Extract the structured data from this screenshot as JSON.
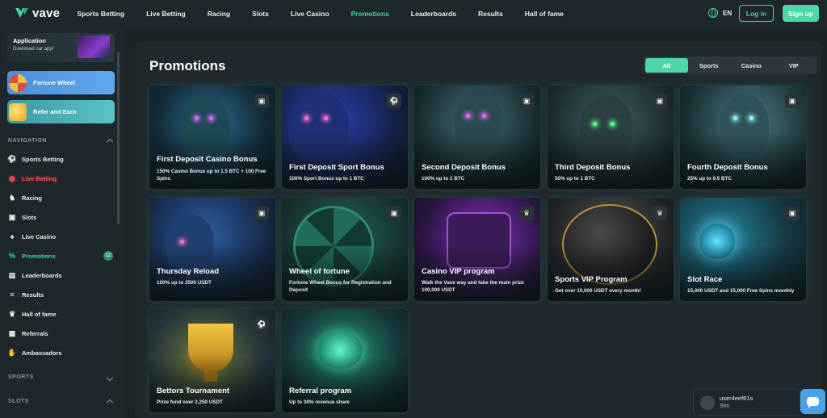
{
  "brand": {
    "name": "vave",
    "accent": "#3fd5a6"
  },
  "nav": {
    "items": [
      "Sports Betting",
      "Live Betting",
      "Racing",
      "Slots",
      "Live Casino",
      "Promotions",
      "Leaderboards",
      "Results",
      "Hall of fame"
    ],
    "active": "Promotions"
  },
  "header": {
    "language": "EN",
    "login_label": "Log in",
    "signup_label": "Sign up"
  },
  "sidebar": {
    "app_card": {
      "title": "Application",
      "subtitle": "Download our app!"
    },
    "promos": [
      {
        "label": "Fortune Wheel",
        "icon": "fortune-wheel-icon"
      },
      {
        "label": "Refer and Earn",
        "icon": "coin-icon"
      }
    ],
    "navigation_heading": "NAVIGATION",
    "items": [
      {
        "label": "Sports Betting",
        "icon": "soccer-ball-icon"
      },
      {
        "label": "Live Betting",
        "icon": "live-signal-icon"
      },
      {
        "label": "Racing",
        "icon": "horse-icon"
      },
      {
        "label": "Slots",
        "icon": "slot-machine-icon"
      },
      {
        "label": "Live Casino",
        "icon": "cards-icon"
      },
      {
        "label": "Promotions",
        "icon": "percent-icon",
        "badge": "12"
      },
      {
        "label": "Leaderboards",
        "icon": "leaderboard-icon"
      },
      {
        "label": "Results",
        "icon": "results-icon"
      },
      {
        "label": "Hall of fame",
        "icon": "trophy-icon"
      },
      {
        "label": "Referrals",
        "icon": "referrals-icon"
      },
      {
        "label": "Ambassadors",
        "icon": "handshake-icon"
      }
    ],
    "sports_heading": "SPORTS",
    "slots_heading": "SLOTS"
  },
  "main": {
    "title": "Promotions",
    "filters": [
      "All",
      "Sports",
      "Casino",
      "VIP"
    ],
    "active_filter": "All",
    "cards": [
      {
        "title": "First Deposit Casino Bonus",
        "desc": "150% Casino Bonus up to 1.5 BTC + 100 Free Spins",
        "tag_icon": "casino-chip-icon"
      },
      {
        "title": "First Deposit Sport Bonus",
        "desc": "100% Sport Bonus up to 1 BTC",
        "tag_icon": "soccer-ball-icon"
      },
      {
        "title": "Second Deposit Bonus",
        "desc": "100% up to 1 BTC",
        "tag_icon": "casino-chip-icon"
      },
      {
        "title": "Third Deposit Bonus",
        "desc": "50% up to 1 BTC",
        "tag_icon": "casino-chip-icon"
      },
      {
        "title": "Fourth Deposit Bonus",
        "desc": "25% up to 0.5 BTC",
        "tag_icon": "casino-chip-icon"
      },
      {
        "title": "Thursday Reload",
        "desc": "100% up to 2500 USDT",
        "tag_icon": "casino-chip-icon"
      },
      {
        "title": "Wheel of fortune",
        "desc": "Fortune Wheel Bonus for Registration and Deposit",
        "tag_icon": "casino-chip-icon"
      },
      {
        "title": "Casino VIP program",
        "desc": "Walk the Vave way and take the main prize 100,000 USDT",
        "tag_icon": "crown-icon"
      },
      {
        "title": "Sports VIP Program",
        "desc": "Get over 10,000 USDT every month!",
        "tag_icon": "crown-icon"
      },
      {
        "title": "Slot Race",
        "desc": "15,000 USDT and 15,000 Free Spins monthly",
        "tag_icon": "casino-chip-icon"
      },
      {
        "title": "Bettors Tournament",
        "desc": "Prize fund over 2,250 USDT",
        "tag_icon": "soccer-ball-icon"
      },
      {
        "title": "Referral program",
        "desc": "Up to 30% revenue share",
        "tag_icon": ""
      }
    ]
  },
  "chat": {
    "username": "user4eef61s",
    "status": "Slm"
  }
}
